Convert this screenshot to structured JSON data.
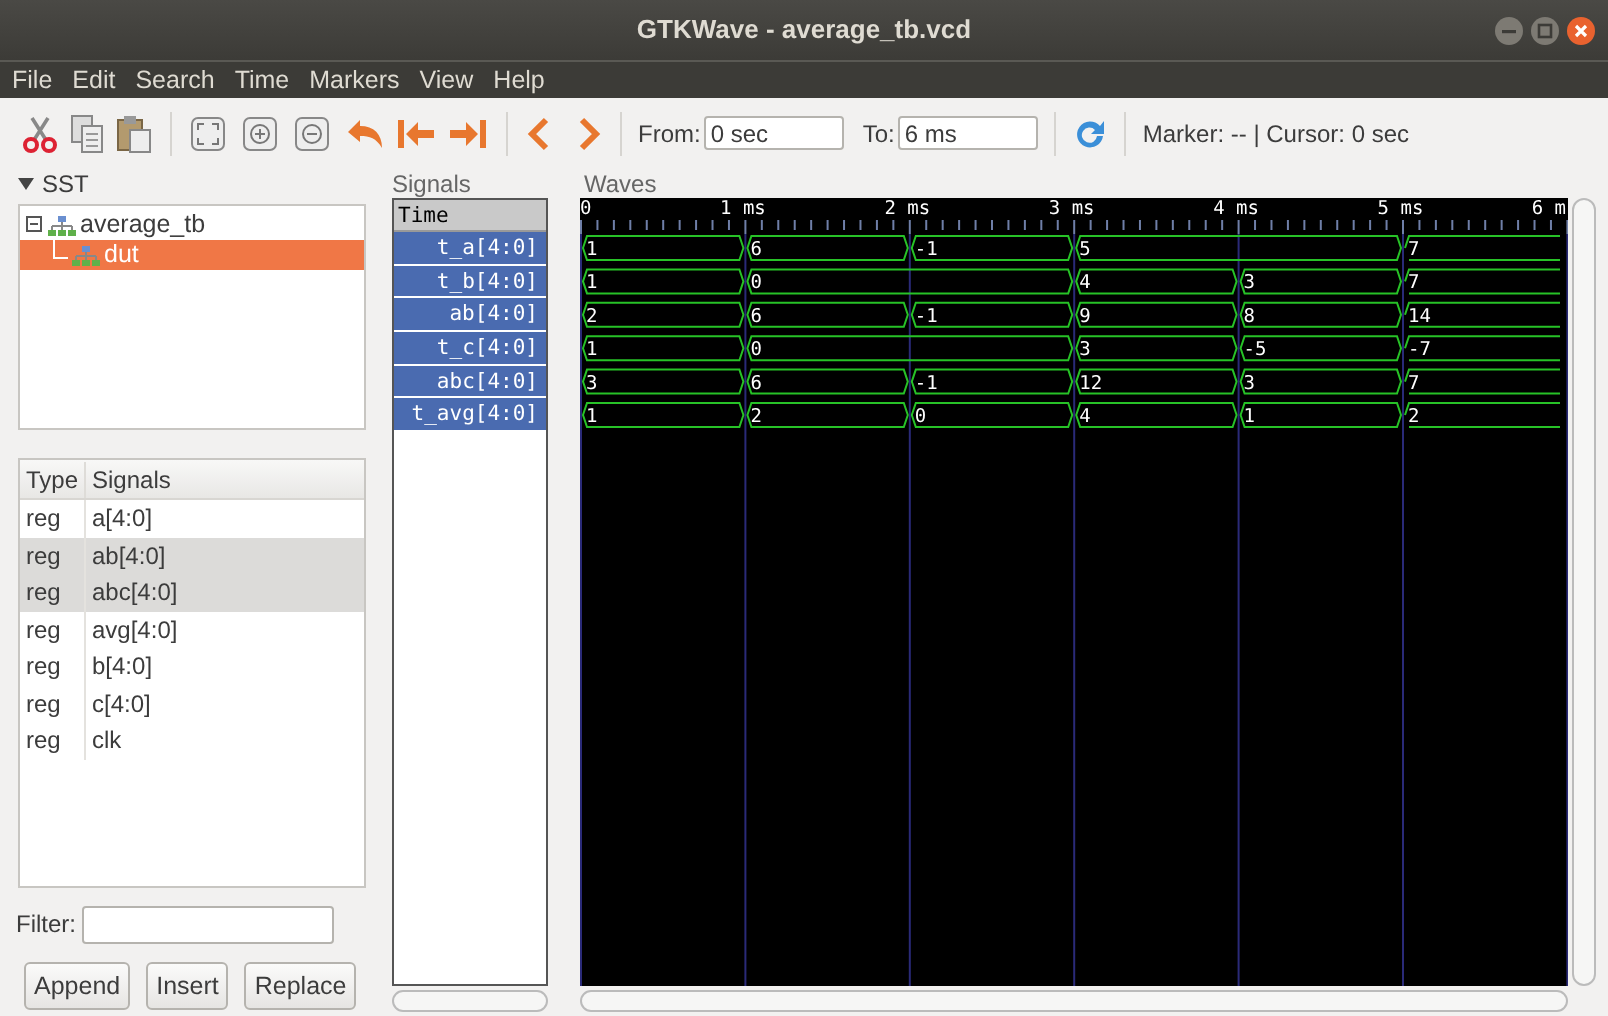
{
  "window": {
    "title": "GTKWave - average_tb.vcd"
  },
  "menu": [
    "File",
    "Edit",
    "Search",
    "Time",
    "Markers",
    "View",
    "Help"
  ],
  "toolbar": {
    "from_label": "From:",
    "from": "0 sec",
    "to_label": "To:",
    "to": "6 ms",
    "status": "Marker: -- | Cursor: 0 sec"
  },
  "sst": {
    "title": "SST",
    "expanded": true,
    "tree": [
      {
        "label": "average_tb",
        "expanded": true,
        "selected": false,
        "children": [
          {
            "label": "dut",
            "selected": true
          }
        ]
      }
    ]
  },
  "signal_table": {
    "columns": [
      "Type",
      "Signals"
    ],
    "rows": [
      {
        "type": "reg",
        "signal": "a[4:0]",
        "selected": false
      },
      {
        "type": "reg",
        "signal": "ab[4:0]",
        "selected": true
      },
      {
        "type": "reg",
        "signal": "abc[4:0]",
        "selected": true
      },
      {
        "type": "reg",
        "signal": "avg[4:0]",
        "selected": false
      },
      {
        "type": "reg",
        "signal": "b[4:0]",
        "selected": false
      },
      {
        "type": "reg",
        "signal": "c[4:0]",
        "selected": false
      },
      {
        "type": "reg",
        "signal": "clk",
        "selected": false
      }
    ]
  },
  "filter": {
    "label": "Filter:"
  },
  "buttons": [
    "Append",
    "Insert",
    "Replace"
  ],
  "signals_panel": {
    "title": "Signals",
    "header": "Time",
    "items": [
      {
        "name": "t_a[4:0]",
        "selected": true
      },
      {
        "name": "t_b[4:0]",
        "selected": true
      },
      {
        "name": "ab[4:0]",
        "selected": true
      },
      {
        "name": "t_c[4:0]",
        "selected": true
      },
      {
        "name": "abc[4:0]",
        "selected": true
      },
      {
        "name": "t_avg[4:0]",
        "selected": true
      }
    ]
  },
  "waves_panel": {
    "title": "Waves",
    "time_labels": [
      "0",
      "1 ms",
      "2 ms",
      "3 ms",
      "4 ms",
      "5 ms",
      "6 m"
    ],
    "traces": [
      {
        "segments": [
          {
            "value": "1",
            "wide": false
          },
          {
            "value": "6",
            "wide": false
          },
          {
            "value": "-1",
            "wide": false
          },
          {
            "value": "5",
            "wide": true
          },
          {
            "value": "7",
            "wide": false
          }
        ]
      },
      {
        "segments": [
          {
            "value": "1",
            "wide": false
          },
          {
            "value": "0",
            "wide": true
          },
          {
            "value": "4",
            "wide": false
          },
          {
            "value": "3",
            "wide": false
          },
          {
            "value": "7",
            "wide": false
          }
        ]
      },
      {
        "segments": [
          {
            "value": "2",
            "wide": false
          },
          {
            "value": "6",
            "wide": false
          },
          {
            "value": "-1",
            "wide": false
          },
          {
            "value": "9",
            "wide": false
          },
          {
            "value": "8",
            "wide": false
          },
          {
            "value": "14",
            "wide": false
          }
        ]
      },
      {
        "segments": [
          {
            "value": "1",
            "wide": false
          },
          {
            "value": "0",
            "wide": true
          },
          {
            "value": "3",
            "wide": false
          },
          {
            "value": "-5",
            "wide": false
          },
          {
            "value": "-7",
            "wide": false
          }
        ]
      },
      {
        "segments": [
          {
            "value": "3",
            "wide": false
          },
          {
            "value": "6",
            "wide": false
          },
          {
            "value": "-1",
            "wide": false
          },
          {
            "value": "12",
            "wide": false
          },
          {
            "value": "3",
            "wide": false
          },
          {
            "value": "7",
            "wide": false
          }
        ]
      },
      {
        "segments": [
          {
            "value": "1",
            "wide": false
          },
          {
            "value": "2",
            "wide": false
          },
          {
            "value": "0",
            "wide": false
          },
          {
            "value": "4",
            "wide": false
          },
          {
            "value": "1",
            "wide": false
          },
          {
            "value": "2",
            "wide": false
          }
        ]
      }
    ]
  }
}
